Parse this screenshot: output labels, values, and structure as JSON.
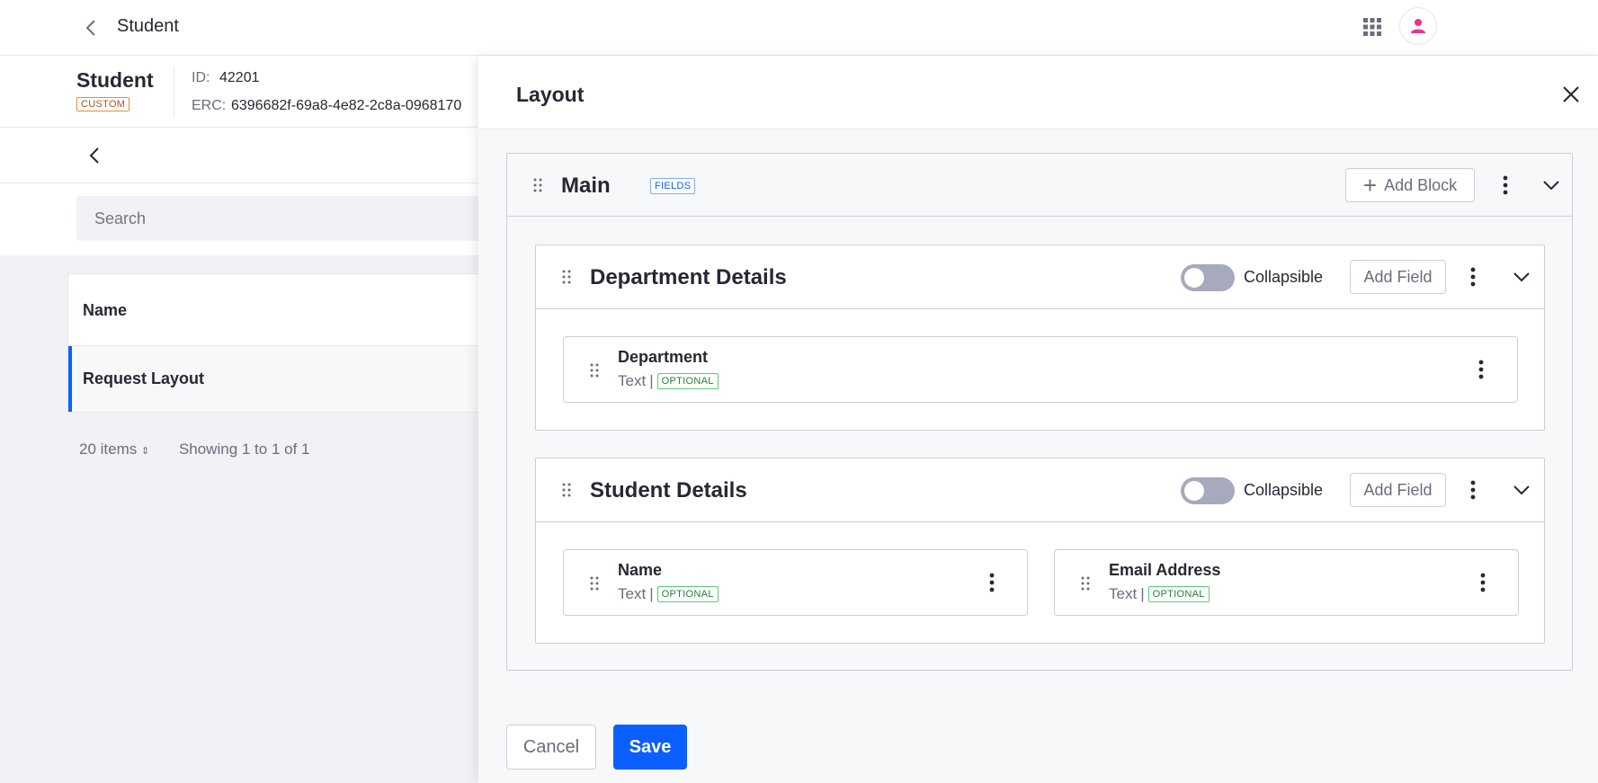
{
  "topbar": {
    "title": "Student",
    "back_icon": "chevron-left-icon",
    "apps_icon": "apps-grid-icon",
    "avatar_icon": "user-icon"
  },
  "object": {
    "name": "Student",
    "type_badge": "CUSTOM",
    "id_label": "ID:",
    "id_value": "42201",
    "erc_label": "ERC:",
    "erc_value": "6396682f-69a8-4e82-2c8a-0968170"
  },
  "search": {
    "placeholder": "Search"
  },
  "table": {
    "header": "Name",
    "rows": [
      "Request Layout"
    ]
  },
  "pager": {
    "items": "20 items",
    "showing": "Showing 1 to 1 of 1"
  },
  "panel": {
    "title": "Layout",
    "block": {
      "title": "Main",
      "badge": "FIELDS",
      "add_block_label": "Add Block",
      "sections": [
        {
          "title": "Department Details",
          "toggle_label": "Collapsible",
          "add_field_label": "Add Field",
          "fields": [
            {
              "name": "Department",
              "type": "Text",
              "badge": "OPTIONAL"
            }
          ]
        },
        {
          "title": "Student Details",
          "toggle_label": "Collapsible",
          "add_field_label": "Add Field",
          "fields": [
            {
              "name": "Name",
              "type": "Text",
              "badge": "OPTIONAL"
            },
            {
              "name": "Email Address",
              "type": "Text",
              "badge": "OPTIONAL"
            }
          ]
        }
      ]
    },
    "cancel_label": "Cancel",
    "save_label": "Save"
  },
  "colors": {
    "primary": "#0b5fff",
    "optional_badge": "#287d3c",
    "custom_badge": "#b95000"
  }
}
